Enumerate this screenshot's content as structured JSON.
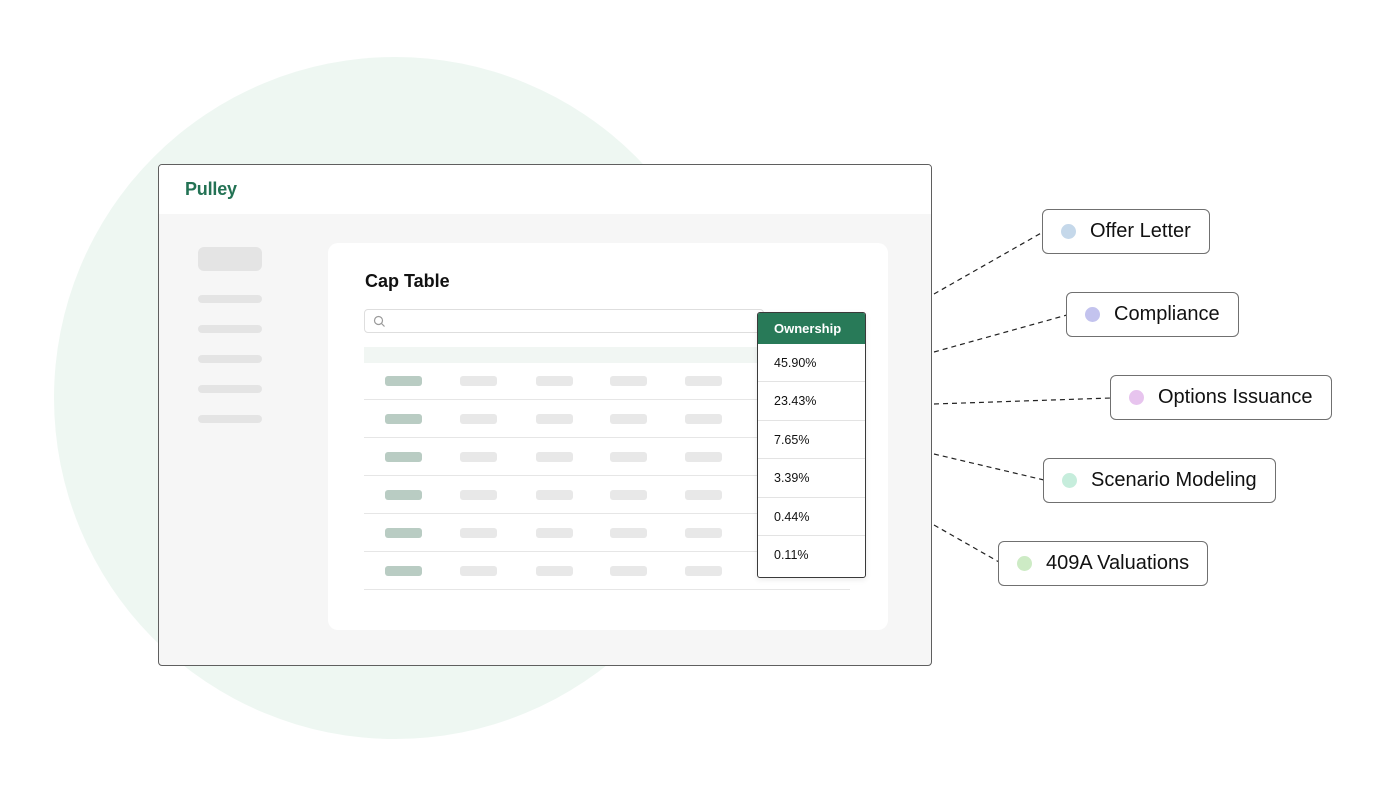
{
  "app": {
    "logo": "Pulley"
  },
  "main": {
    "title": "Cap Table",
    "search": {
      "placeholder": ""
    },
    "ownership": {
      "header": "Ownership",
      "values": [
        "45.90%",
        "23.43%",
        "7.65%",
        "3.39%",
        "0.44%",
        "0.11%"
      ]
    }
  },
  "features": [
    {
      "label": "Offer Letter",
      "color": "#c5d8ea"
    },
    {
      "label": "Compliance",
      "color": "#c3c3ee"
    },
    {
      "label": "Options Issuance",
      "color": "#e7c4ee"
    },
    {
      "label": "Scenario Modeling",
      "color": "#c6eddc"
    },
    {
      "label": "409A Valuations",
      "color": "#cdebc5"
    }
  ],
  "colors": {
    "brand": "#237254",
    "ownership_header": "#287a58",
    "background_circle": "#eef7f2"
  }
}
